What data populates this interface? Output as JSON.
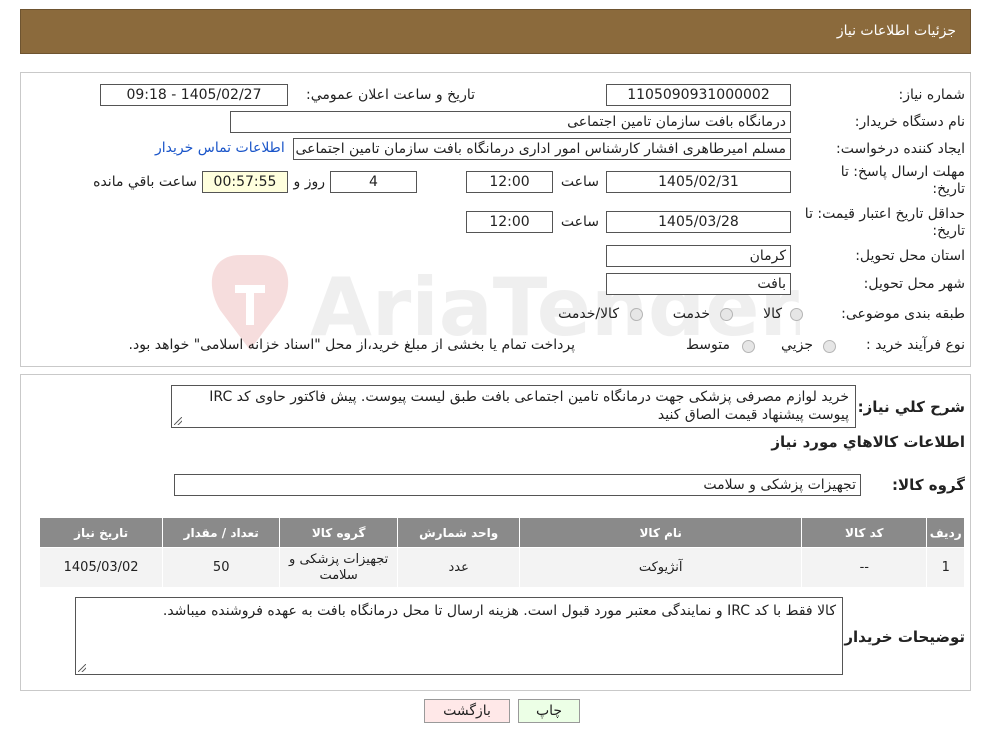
{
  "header": {
    "title": "جزئیات اطلاعات نیاز"
  },
  "watermark": {
    "text": "AriaTender.neT"
  },
  "form": {
    "need_number_label": "شماره نیاز:",
    "need_number": "1105090931000002",
    "announce_label": "تاریخ و ساعت اعلان عمومي:",
    "announce_value": "1405/02/27 - 09:18",
    "buyer_org_label": "نام دستگاه خریدار:",
    "buyer_org": "درمانگاه بافت سازمان تامین اجتماعی",
    "creator_label": "ایجاد کننده درخواست:",
    "creator": "مسلم امیرطاهری افشار کارشناس امور اداری درمانگاه بافت سازمان تامین اجتماعی",
    "contact_link": "اطلاعات تماس خریدار",
    "deadline_label": "مهلت ارسال پاسخ: تا تاریخ:",
    "deadline_date": "1405/02/31",
    "time_label": "ساعت",
    "deadline_time": "12:00",
    "days_value": "4",
    "days_label": "روز و",
    "remaining_time": "00:57:55",
    "remaining_label": "ساعت باقي مانده",
    "validity_label": "حداقل تاریخ اعتبار قیمت: تا تاریخ:",
    "validity_date": "1405/03/28",
    "validity_time": "12:00",
    "province_label": "استان محل تحویل:",
    "province": "کرمان",
    "city_label": "شهر محل تحویل:",
    "city": "بافت",
    "category_label": "طبقه بندی موضوعی:",
    "category_options": [
      "کالا",
      "خدمت",
      "کالا/خدمت"
    ],
    "process_label": "نوع فرآیند خرید :",
    "process_options": [
      "جزيي",
      "متوسط"
    ],
    "process_note": "پرداخت تمام یا بخشی از مبلغ خرید،از محل \"اسناد خزانه اسلامی\" خواهد بود."
  },
  "description": {
    "label": "شرح کلي نیاز:",
    "text": "خرید لوازم مصرفی پزشکی جهت درمانگاه تامین اجتماعی بافت طبق لیست پیوست. پیش فاکتور حاوی کد IRC پیوست پیشنهاد قیمت الصاق کنید"
  },
  "items_info": {
    "heading": "اطلاعات کالاهاي مورد نیاز"
  },
  "goods_group": {
    "label": "گروه کالا:",
    "value": "تجهیزات پزشکی و سلامت"
  },
  "table": {
    "headers": [
      "ردیف",
      "کد کالا",
      "نام کالا",
      "واحد شمارش",
      "گروه کالا",
      "تعداد / مقدار",
      "تاریخ نیاز"
    ],
    "rows": [
      [
        "1",
        "--",
        "آنژیوکت",
        "عدد",
        "تجهیزات پزشکی و سلامت",
        "50",
        "1405/03/02"
      ]
    ]
  },
  "buyer_notes": {
    "label": "توضیحات خریدار:",
    "text": "کالا فقط با کد IRC و نمایندگی معتبر مورد قبول است. هزینه ارسال تا محل درمانگاه بافت به عهده فروشنده میباشد."
  },
  "buttons": {
    "print": "چاپ",
    "back": "بازگشت"
  },
  "colors": {
    "header_bg": "#8b6a3c",
    "link": "#1a55c9",
    "table_header": "#8a8a8a"
  }
}
